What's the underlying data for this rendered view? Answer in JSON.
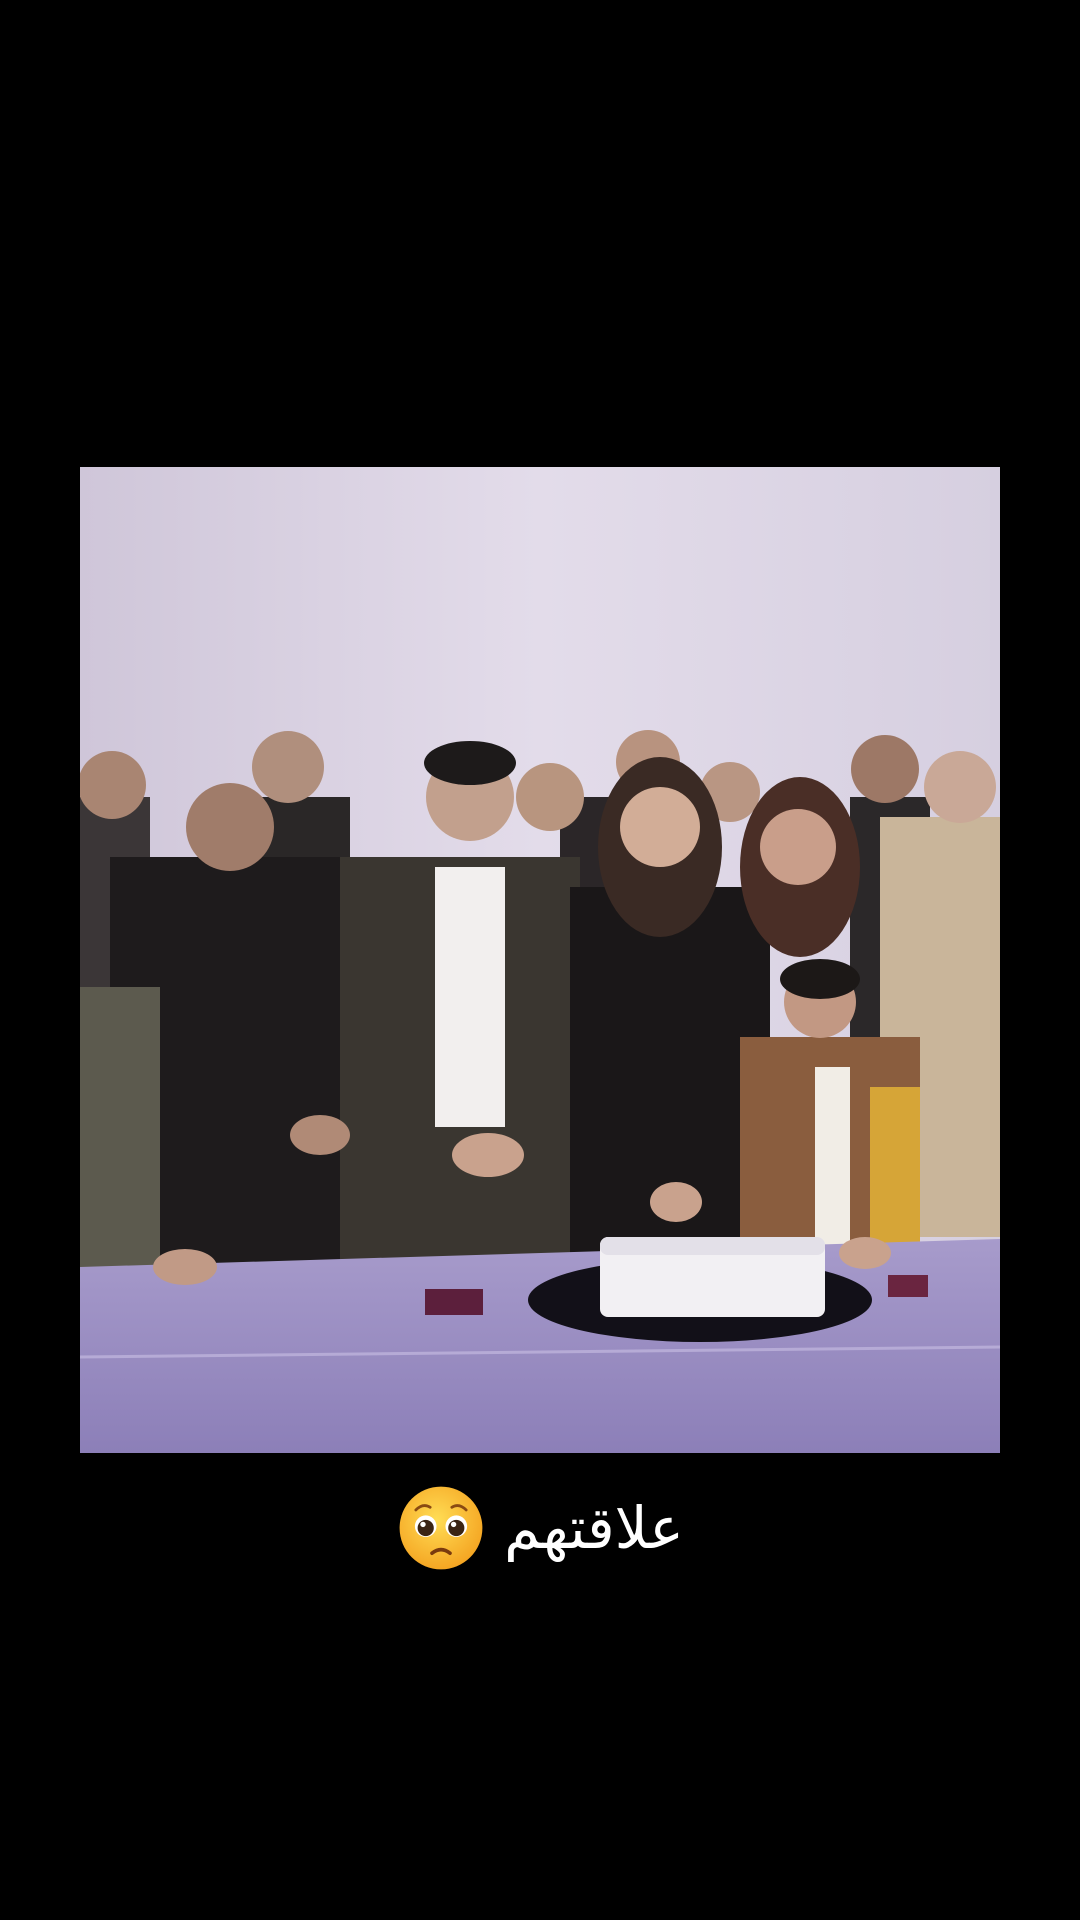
{
  "photo": {
    "subject": "group-photo-with-cake"
  },
  "caption": {
    "text": "علاقتهم",
    "emoji_icon": "pleading-face-emoji"
  },
  "colors": {
    "background": "#000000",
    "caption_text": "#ffffff",
    "wall": "#d9d2e4",
    "tablecloth": "#9a8cc0"
  }
}
